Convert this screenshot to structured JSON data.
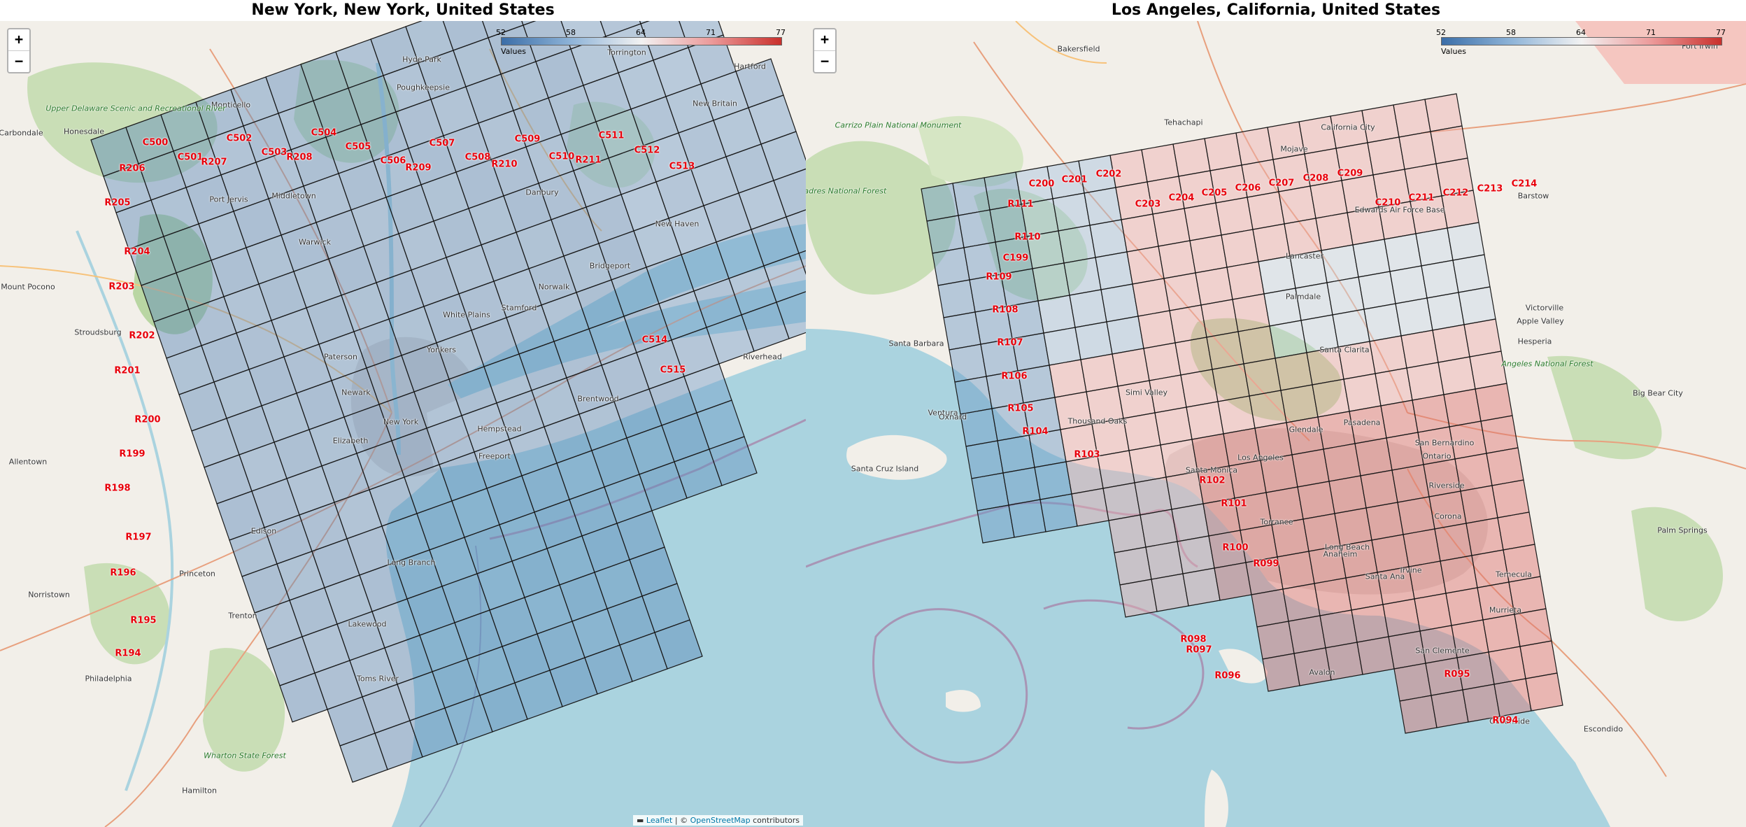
{
  "panels": [
    {
      "id": "ny",
      "title": "New York, New York, United States",
      "legend": {
        "ticks": [
          "52",
          "58",
          "64",
          "71",
          "77"
        ],
        "caption": "Values"
      },
      "zoom": {
        "in": "+",
        "out": "−"
      },
      "labels": [
        "C500",
        "C501",
        "C502",
        "C503",
        "C504",
        "C505",
        "C506",
        "C507",
        "C508",
        "C509",
        "C510",
        "C511",
        "C512",
        "C513",
        "C514",
        "C515",
        "R194",
        "R195",
        "R196",
        "R197",
        "R198",
        "R199",
        "R200",
        "R201",
        "R202",
        "R203",
        "R204",
        "R205",
        "R206",
        "R207",
        "R208",
        "R209",
        "R210",
        "R211"
      ],
      "places": [
        "Carbondale",
        "Honesdale",
        "Monticello",
        "Hyde Park",
        "Poughkeepsie",
        "Hartford",
        "New Britain",
        "Torrington",
        "Danbury",
        "New Haven",
        "Bridgeport",
        "Stamford",
        "Norwalk",
        "White Plains",
        "Yonkers",
        "New York",
        "Newark",
        "Elizabeth",
        "Paterson",
        "Hempstead",
        "Brentwood",
        "Trenton",
        "Lakewood",
        "Toms River",
        "Philadelphia",
        "Norristown",
        "Allentown",
        "Stroudsburg",
        "Hamilton",
        "Long Branch",
        "Middletown",
        "Port Jervis",
        "Warwick",
        "Edison",
        "Princeton",
        "Freeport",
        "Mount Pocono",
        "Riverhead",
        "Upper Delaware Scenic and Recreational River",
        "Wharton State Forest"
      ],
      "attribution": {
        "leaflet": "Leaflet",
        "sep": " | © ",
        "osm": "OpenStreetMap",
        "tail": " contributors"
      }
    },
    {
      "id": "la",
      "title": "Los Angeles, California, United States",
      "legend": {
        "ticks": [
          "52",
          "58",
          "64",
          "71",
          "77"
        ],
        "caption": "Values"
      },
      "zoom": {
        "in": "+",
        "out": "−"
      },
      "labels": [
        "C199",
        "C200",
        "C201",
        "C202",
        "C203",
        "C204",
        "C205",
        "C206",
        "C207",
        "C208",
        "C209",
        "C210",
        "C211",
        "C212",
        "C213",
        "C214",
        "R094",
        "R095",
        "R096",
        "R097",
        "R098",
        "R099",
        "R100",
        "R101",
        "R102",
        "R103",
        "R104",
        "R105",
        "R106",
        "R107",
        "R108",
        "R109",
        "R110",
        "R111"
      ],
      "places": [
        "Bakersfield",
        "Tehachapi",
        "Mojave",
        "California City",
        "Barstow",
        "Lancaster",
        "Palmdale",
        "Victorville",
        "Hesperia",
        "Apple Valley",
        "Santa Clarita",
        "Santa Barbara",
        "Ventura",
        "Oxnard",
        "Thousand Oaks",
        "Simi Valley",
        "Santa Monica",
        "Los Angeles",
        "Glendale",
        "Pasadena",
        "Long Beach",
        "Torrance",
        "Anaheim",
        "Santa Ana",
        "Irvine",
        "Riverside",
        "San Bernardino",
        "Ontario",
        "Corona",
        "Temecula",
        "Murrieta",
        "San Clemente",
        "Oceanside",
        "Escondido",
        "Palm Springs",
        "Big Bear City",
        "Santa Cruz Island",
        "Avalon",
        "Los Padres National Forest",
        "Carrizo Plain National Monument",
        "Edwards Air Force Base",
        "Fort Irwin",
        "Angeles National Forest"
      ],
      "attribution": {
        "leaflet": "",
        "sep": "",
        "osm": "",
        "tail": ""
      }
    }
  ],
  "colors": {
    "label": "#e8000b",
    "low": "#3b6ea8",
    "high": "#c9302c",
    "mid": "#f2f2f2",
    "water": "#aad3df",
    "land": "#f2efe9",
    "forest": "#add19e",
    "grid": "#1a1a1a"
  }
}
